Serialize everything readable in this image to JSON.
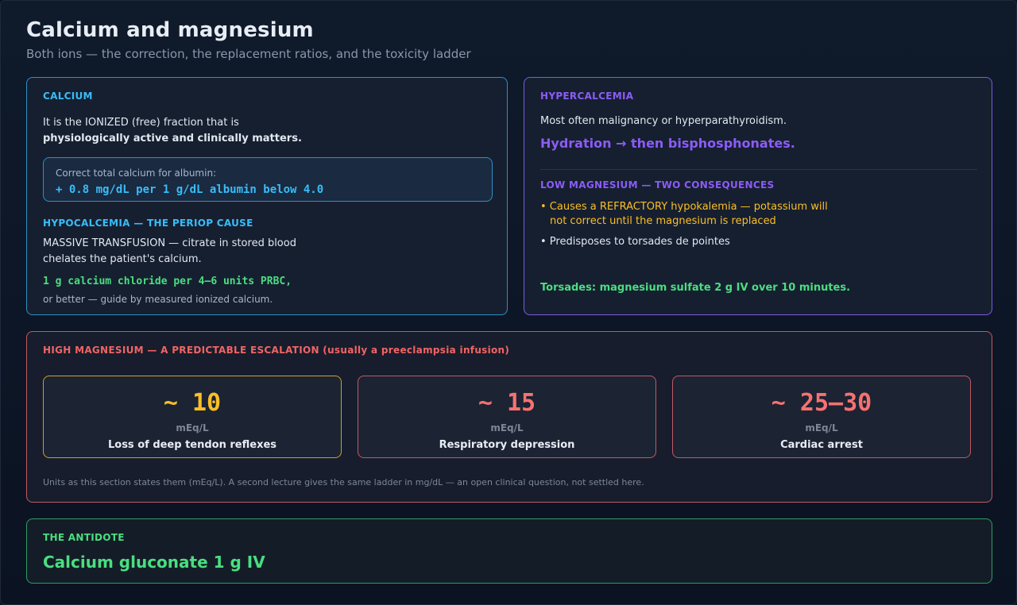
{
  "page": {
    "title": "Calcium and magnesium",
    "subtitle": "Both ions — the correction, the replacement ratios, and the toxicity ladder"
  },
  "calcium": {
    "heading": "CALCIUM",
    "intro_line1": "It is the IONIZED (free) fraction that is",
    "intro_line2": "physiologically active and clinically matters.",
    "correction_label": "Correct total calcium for albumin:",
    "correction_formula": "+ 0.8 mg/dL per 1 g/dL albumin below 4.0",
    "hypo_heading": "HYPOCALCEMIA — THE PERIOP CAUSE",
    "hypo_line1": "MASSIVE TRANSFUSION — citrate in stored blood",
    "hypo_line2": "chelates the patient's calcium.",
    "dose": "1 g calcium chloride per 4–6 units PRBC,",
    "dose_note": "or better — guide by measured ionized calcium."
  },
  "hypercalcemia": {
    "heading": "HYPERCALCEMIA",
    "cause": "Most often malignancy or hyperparathyroidism.",
    "treatment": "Hydration → then bisphosphonates.",
    "lowmg_heading": "LOW MAGNESIUM — TWO CONSEQUENCES",
    "bullet1_line1": "• Causes a REFRACTORY hypokalemia — potassium will",
    "bullet1_line2": "not correct until the magnesium is replaced",
    "bullet2": "• Predisposes to torsades de pointes",
    "torsades": "Torsades: magnesium sulfate 2 g IV over 10 minutes."
  },
  "high_magnesium": {
    "heading": "HIGH MAGNESIUM — A PREDICTABLE ESCALATION (usually a preeclampsia infusion)",
    "tiers": [
      {
        "value": "~ 10",
        "unit": "mEq/L",
        "effect": "Loss of deep tendon reflexes",
        "color": "#fbbf24",
        "border": "#c9a227"
      },
      {
        "value": "~ 15",
        "unit": "mEq/L",
        "effect": "Respiratory depression",
        "color": "#f87171",
        "border": "#c05a63"
      },
      {
        "value": "~ 25–30",
        "unit": "mEq/L",
        "effect": "Cardiac arrest",
        "color": "#f87171",
        "border": "#c05a63"
      }
    ],
    "footnote": "Units as this section states them (mEq/L). A second lecture gives the same ladder in mg/dL — an open clinical question, not settled here."
  },
  "antidote": {
    "heading": "THE ANTIDOTE",
    "text": "Calcium gluconate 1 g IV"
  },
  "colors": {
    "calcium_accent": "#38bdf8",
    "hyper_accent": "#8b5cf6",
    "warning_yellow": "#fbbf24",
    "danger_red": "#f87171",
    "success_green": "#4ade80"
  }
}
